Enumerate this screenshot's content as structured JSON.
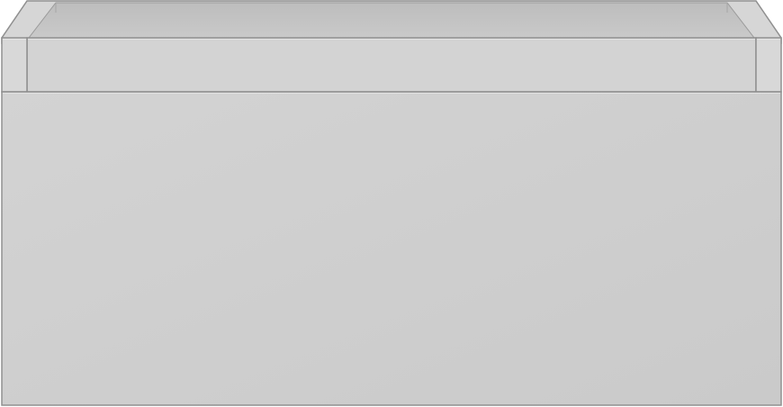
{
  "scene": {
    "subject": "drawer-unit",
    "colors": {
      "background": "#ffffff",
      "front_panel": "#cdcdcd",
      "front_panel_light": "#d2d2d2",
      "top_rim": "#d3d3d3",
      "inner_back_wall": "#c6c6c6",
      "inner_shadow": "#b9b9b9",
      "side_post": "#d6d6d6",
      "outline": "#8f8f8f",
      "edge_highlight": "#e6e6e6"
    }
  }
}
